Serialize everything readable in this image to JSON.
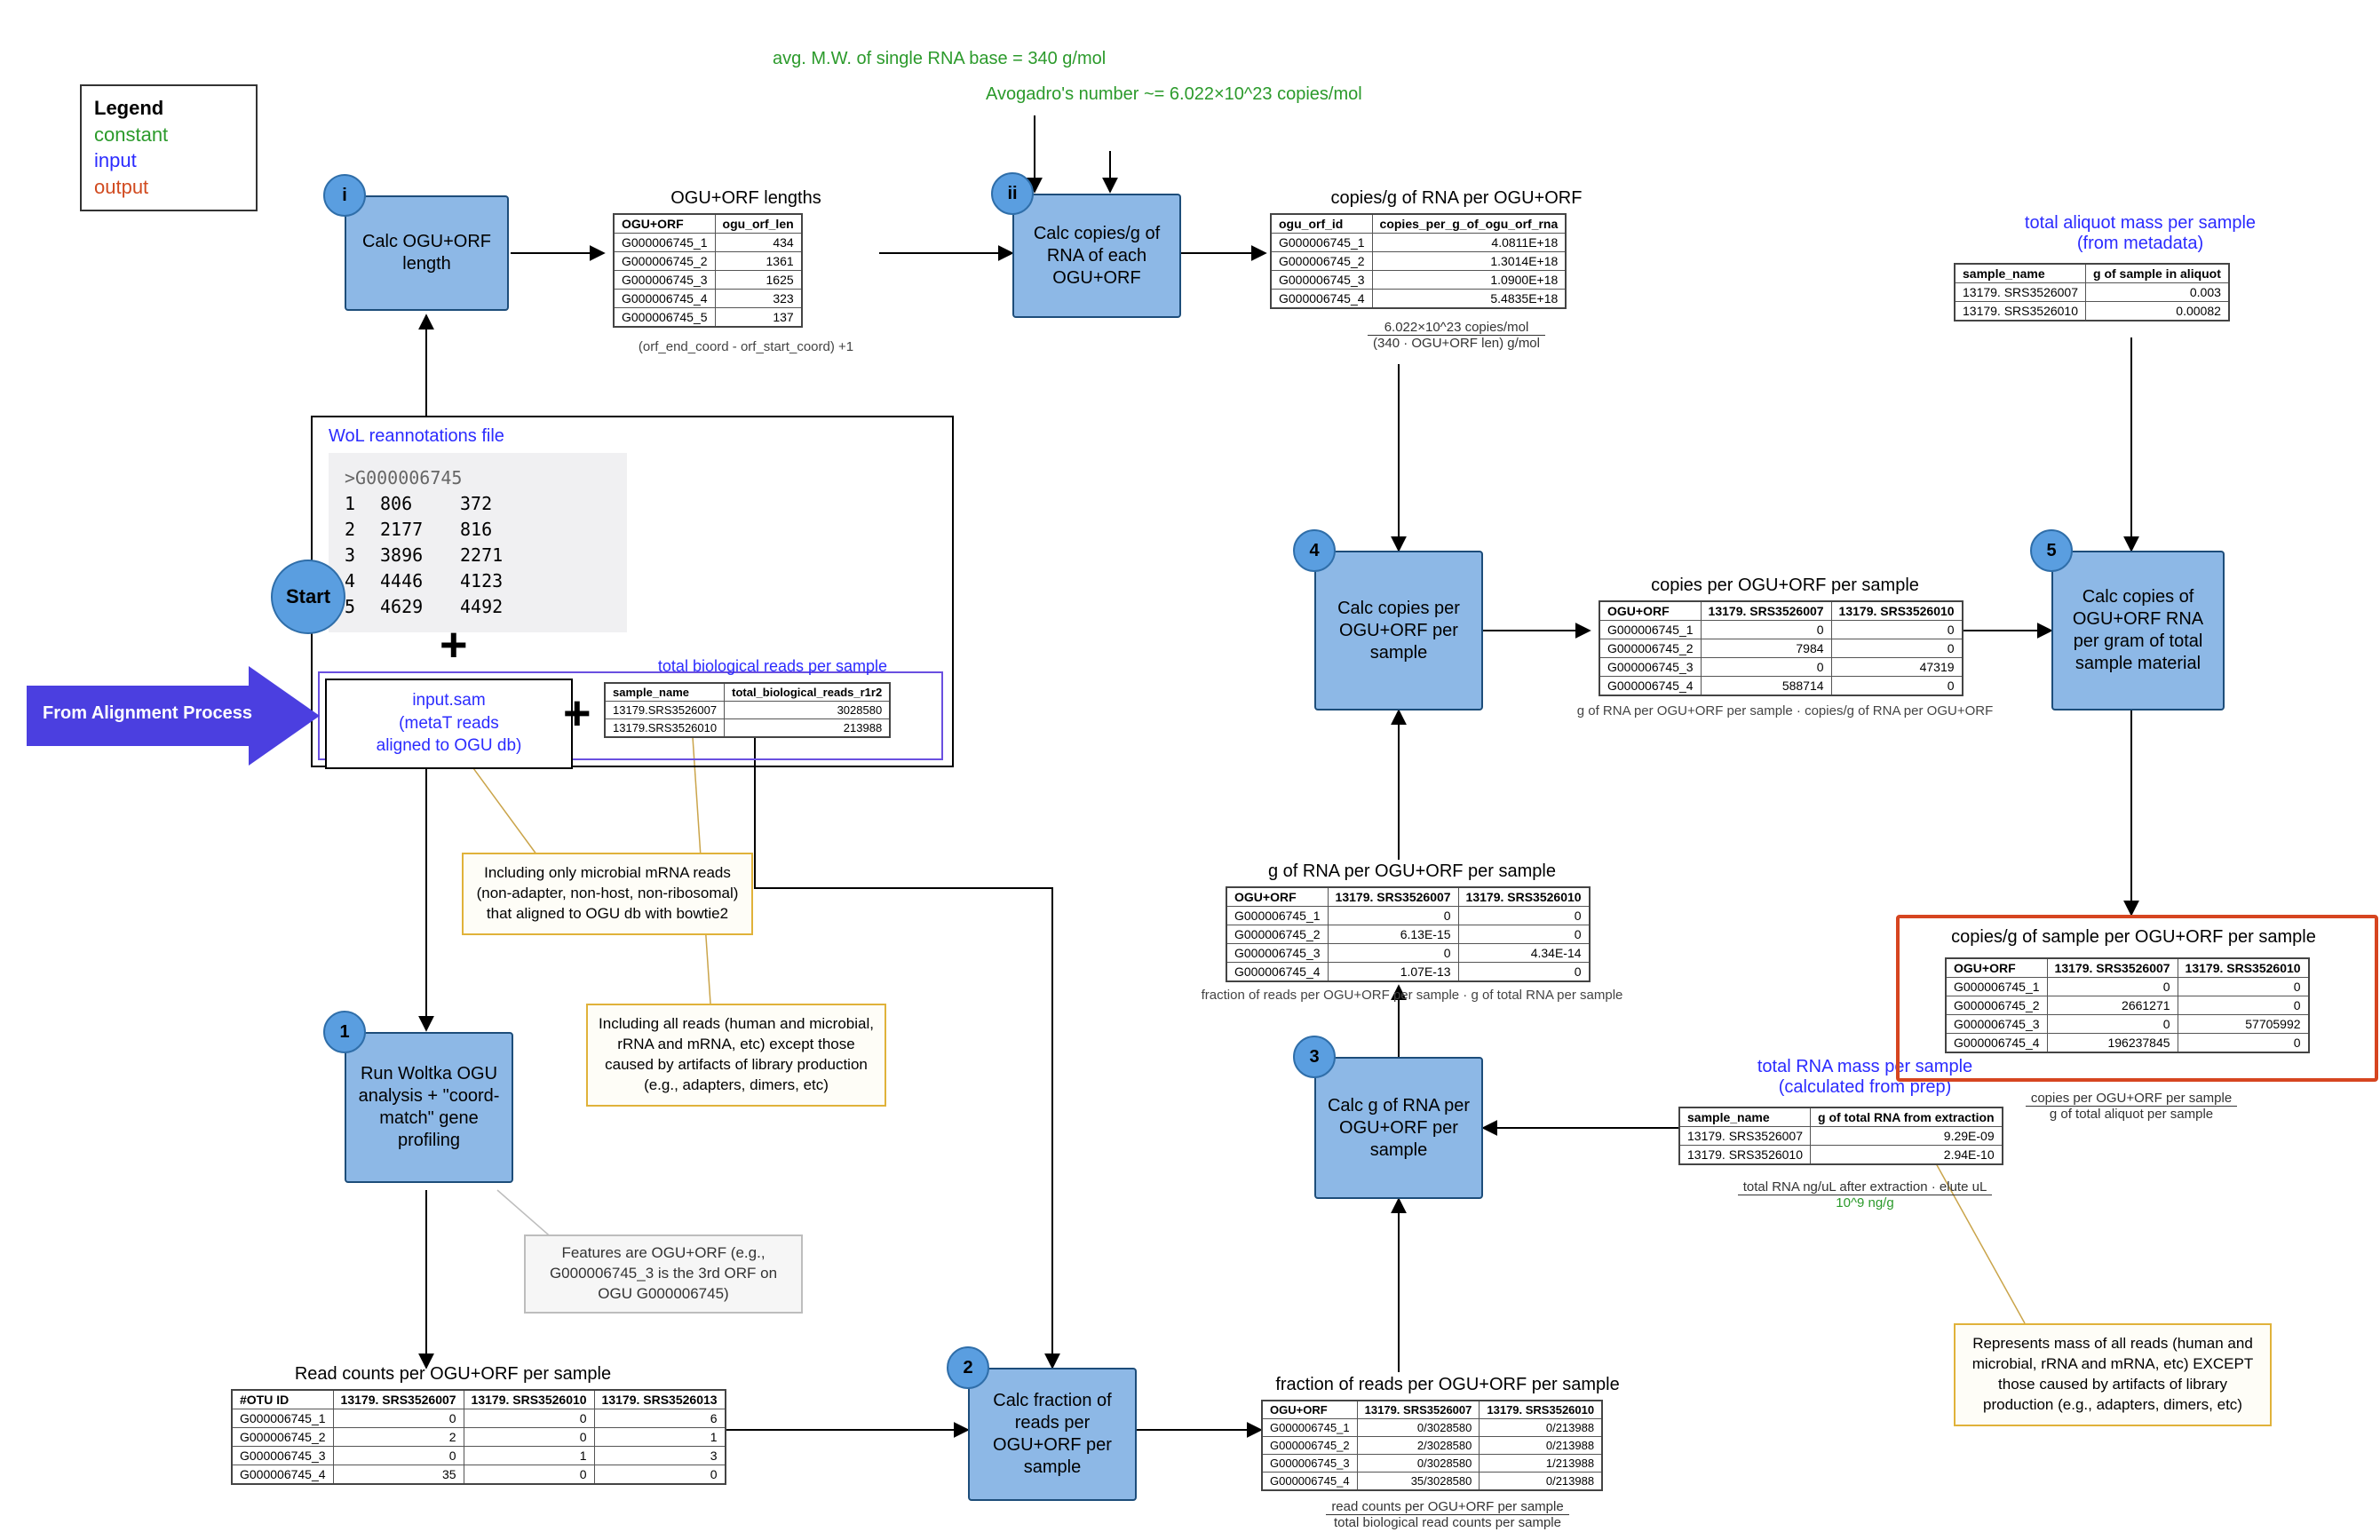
{
  "legend": {
    "title": "Legend",
    "constant": "constant",
    "input": "input",
    "output": "output"
  },
  "constants": {
    "mw": "avg. M.W. of single RNA base = 340 g/mol",
    "avogadro": "Avogadro's number ~= 6.022×10^23 copies/mol"
  },
  "steps": {
    "i": "Calc OGU+ORF length",
    "ii": "Calc copies/g of RNA of each OGU+ORF",
    "one": "Run Woltka OGU analysis + \"coord-match\" gene profiling",
    "two": "Calc fraction of reads per OGU+ORF per sample",
    "three": "Calc g of RNA per OGU+ORF per sample",
    "four": "Calc copies per OGU+ORF per sample",
    "five": "Calc copies of OGU+ORF RNA per gram of total sample material",
    "start": "Start"
  },
  "inputs": {
    "wol_title": "WoL reannotations file",
    "wol_header": ">G000006745",
    "wol_rows": [
      [
        "1",
        "806",
        "372"
      ],
      [
        "2",
        "2177",
        "816"
      ],
      [
        "3",
        "3896",
        "2271"
      ],
      [
        "4",
        "4446",
        "4123"
      ],
      [
        "5",
        "4629",
        "4492"
      ]
    ],
    "sam": "input.sam\n(metaT reads\naligned to OGU db)",
    "bio_title": "total biological reads per sample",
    "bio_cols": [
      "sample_name",
      "total_biological_reads_r1r2"
    ],
    "bio_rows": [
      [
        "13179.SRS3526007",
        "3028580"
      ],
      [
        "13179.SRS3526010",
        "213988"
      ]
    ],
    "aliquot_title": "total aliquot mass per sample\n(from metadata)",
    "aliquot_cols": [
      "sample_name",
      "g of sample in aliquot"
    ],
    "aliquot_rows": [
      [
        "13179. SRS3526007",
        "0.003"
      ],
      [
        "13179. SRS3526010",
        "0.00082"
      ]
    ],
    "rna_mass_title": "total RNA mass per sample\n(calculated from prep)",
    "rna_mass_cols": [
      "sample_name",
      "g of total RNA from extraction"
    ],
    "rna_mass_rows": [
      [
        "13179. SRS3526007",
        "9.29E-09"
      ],
      [
        "13179. SRS3526010",
        "2.94E-10"
      ]
    ],
    "rna_mass_formula_num": "total RNA ng/uL after extraction · elute uL",
    "rna_mass_formula_den": "10^9 ng/g",
    "alignment_label": "From Alignment Process"
  },
  "tables": {
    "orf_len_title": "OGU+ORF lengths",
    "orf_len_cols": [
      "OGU+ORF",
      "ogu_orf_len"
    ],
    "orf_len_rows": [
      [
        "G000006745_1",
        "434"
      ],
      [
        "G000006745_2",
        "1361"
      ],
      [
        "G000006745_3",
        "1625"
      ],
      [
        "G000006745_4",
        "323"
      ],
      [
        "G000006745_5",
        "137"
      ]
    ],
    "orf_len_formula": "(orf_end_coord - orf_start_coord) +1",
    "copies_g_title": "copies/g of RNA per OGU+ORF",
    "copies_g_cols": [
      "ogu_orf_id",
      "copies_per_g_of_ogu_orf_rna"
    ],
    "copies_g_rows": [
      [
        "G000006745_1",
        "4.0811E+18"
      ],
      [
        "G000006745_2",
        "1.3014E+18"
      ],
      [
        "G000006745_3",
        "1.0900E+18"
      ],
      [
        "G000006745_4",
        "5.4835E+18"
      ]
    ],
    "copies_g_formula_num": "6.022×10^23 copies/mol",
    "copies_g_formula_den": "(340 · OGU+ORF len) g/mol",
    "read_counts_title": "Read counts per OGU+ORF per sample",
    "read_counts_cols": [
      "#OTU ID",
      "13179. SRS3526007",
      "13179. SRS3526010",
      "13179. SRS3526013"
    ],
    "read_counts_rows": [
      [
        "G000006745_1",
        "0",
        "0",
        "6"
      ],
      [
        "G000006745_2",
        "2",
        "0",
        "1"
      ],
      [
        "G000006745_3",
        "0",
        "1",
        "3"
      ],
      [
        "G000006745_4",
        "35",
        "0",
        "0"
      ]
    ],
    "fraction_title": "fraction of reads per OGU+ORF per sample",
    "fraction_cols": [
      "OGU+ORF",
      "13179. SRS3526007",
      "13179. SRS3526010"
    ],
    "fraction_rows": [
      [
        "G000006745_1",
        "0/3028580",
        "0/213988"
      ],
      [
        "G000006745_2",
        "2/3028580",
        "0/213988"
      ],
      [
        "G000006745_3",
        "0/3028580",
        "1/213988"
      ],
      [
        "G000006745_4",
        "35/3028580",
        "0/213988"
      ]
    ],
    "fraction_formula_num": "read counts per OGU+ORF per sample",
    "fraction_formula_den": "total biological read counts per sample",
    "g_rna_title": "g of RNA per OGU+ORF per sample",
    "g_rna_cols": [
      "OGU+ORF",
      "13179. SRS3526007",
      "13179. SRS3526010"
    ],
    "g_rna_rows": [
      [
        "G000006745_1",
        "0",
        "0"
      ],
      [
        "G000006745_2",
        "6.13E-15",
        "0"
      ],
      [
        "G000006745_3",
        "0",
        "4.34E-14"
      ],
      [
        "G000006745_4",
        "1.07E-13",
        "0"
      ]
    ],
    "g_rna_formula": "fraction of reads per OGU+ORF per sample · g of total RNA per sample",
    "copies_per_title": "copies per OGU+ORF per sample",
    "copies_per_cols": [
      "OGU+ORF",
      "13179. SRS3526007",
      "13179. SRS3526010"
    ],
    "copies_per_rows": [
      [
        "G000006745_1",
        "0",
        "0"
      ],
      [
        "G000006745_2",
        "7984",
        "0"
      ],
      [
        "G000006745_3",
        "0",
        "47319"
      ],
      [
        "G000006745_4",
        "588714",
        "0"
      ]
    ],
    "copies_per_formula": "g of RNA per OGU+ORF per sample · copies/g of RNA per OGU+ORF",
    "output_title": "copies/g of sample per OGU+ORF per sample",
    "output_cols": [
      "OGU+ORF",
      "13179. SRS3526007",
      "13179. SRS3526010"
    ],
    "output_rows": [
      [
        "G000006745_1",
        "0",
        "0"
      ],
      [
        "G000006745_2",
        "2661271",
        "0"
      ],
      [
        "G000006745_3",
        "0",
        "57705992"
      ],
      [
        "G000006745_4",
        "196237845",
        "0"
      ]
    ],
    "output_formula_num": "copies per OGU+ORF per sample",
    "output_formula_den": "g of total aliquot per sample"
  },
  "notes": {
    "sam_note": "Including only microbial mRNA reads (non-adapter, non-host, non-ribosomal) that aligned to OGU db with bowtie2",
    "bio_note": "Including all reads (human and microbial, rRNA and mRNA, etc) except those caused by artifacts of library production (e.g., adapters, dimers, etc)",
    "feature_note": "Features are OGU+ORF (e.g., G000006745_3 is the 3rd ORF on OGU G000006745)",
    "rna_mass_note": "Represents mass of all reads (human and microbial, rRNA and mRNA, etc) EXCEPT those caused by artifacts of library production (e.g., adapters, dimers, etc)"
  }
}
